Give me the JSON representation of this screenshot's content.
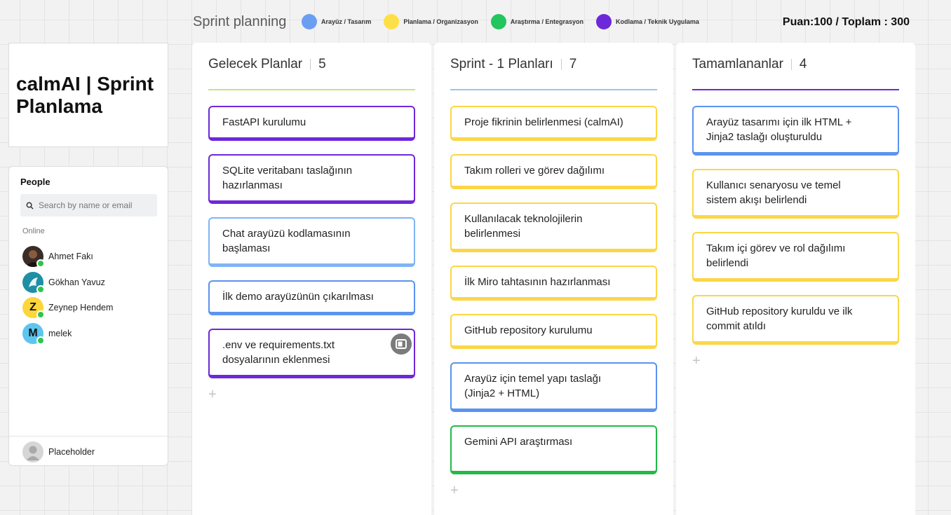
{
  "header": {
    "title": "Sprint planning",
    "score": "Puan:100 / Toplam : 300",
    "legend": [
      {
        "label": "Arayüz / Tasarım",
        "color": "#6a9ef2"
      },
      {
        "label": "Planlama / Organizasyon",
        "color": "#fde047"
      },
      {
        "label": "Araştırma / Entegrasyon",
        "color": "#22c55e"
      },
      {
        "label": "Kodlama / Teknik Uygulama",
        "color": "#6d28d9"
      }
    ]
  },
  "board_title": "calmAI | Sprint Planlama",
  "people": {
    "heading": "People",
    "search_placeholder": "Search by name or email",
    "online_label": "Online",
    "members": [
      {
        "name": "Ahmet Fakı",
        "initial": "",
        "color": "#3a2d28"
      },
      {
        "name": "Gökhan Yavuz",
        "initial": "",
        "color": "#1f8fa5"
      },
      {
        "name": "Zeynep Hendem",
        "initial": "Z",
        "color": "#fcd63a"
      },
      {
        "name": "melek",
        "initial": "M",
        "color": "#5cc6ee"
      }
    ],
    "footer_name": "Placeholder"
  },
  "columns": [
    {
      "title": "Gelecek Planlar",
      "count": "5",
      "rule_color": "#c9e27d",
      "cards": [
        {
          "text": "FastAPI kurulumu",
          "color": "#6d28d9"
        },
        {
          "text": "SQLite veritabanı taslağının hazırlanması",
          "color": "#6d28d9"
        },
        {
          "text": "Chat arayüzü kodlamasının başlaması",
          "color": "#80b4f5"
        },
        {
          "text": "İlk demo arayüzünün çıkarılması",
          "color": "#5b93ef"
        },
        {
          "text": ".env ve requirements.txt dosyalarının eklenmesi",
          "color": "#6d28d9"
        }
      ]
    },
    {
      "title": "Sprint - 1 Planları",
      "count": "7",
      "rule_color": "#9cc3f5",
      "cards": [
        {
          "text": "Proje fikrinin belirlenmesi (calmAI)",
          "color": "#fcd646"
        },
        {
          "text": "Takım rolleri ve görev dağılımı",
          "color": "#fcd646"
        },
        {
          "text": "Kullanılacak teknolojilerin belirlenmesi",
          "color": "#fcd646"
        },
        {
          "text": "İlk Miro tahtasının hazırlanması",
          "color": "#fcd646"
        },
        {
          "text": "GitHub repository kurulumu",
          "color": "#fcd646"
        },
        {
          "text": "Arayüz için temel yapı taslağı (Jinja2 + HTML)",
          "color": "#5b93ef"
        },
        {
          "text": "Gemini API araştırması",
          "color": "#22b948"
        }
      ]
    },
    {
      "title": "Tamamlananlar",
      "count": "4",
      "rule_color": "#6d28d9",
      "cards": [
        {
          "text": "Arayüz tasarımı için ilk HTML + Jinja2 taslağı oluşturuldu",
          "color": "#5b93ef"
        },
        {
          "text": "Kullanıcı senaryosu ve temel sistem akışı belirlendi",
          "color": "#fcd646"
        },
        {
          "text": "Takım içi görev ve rol dağılımı belirlendi",
          "color": "#fcd646"
        },
        {
          "text": "GitHub repository kuruldu ve ilk commit atıldı",
          "color": "#fcd646"
        }
      ]
    }
  ],
  "add_symbol": "+"
}
